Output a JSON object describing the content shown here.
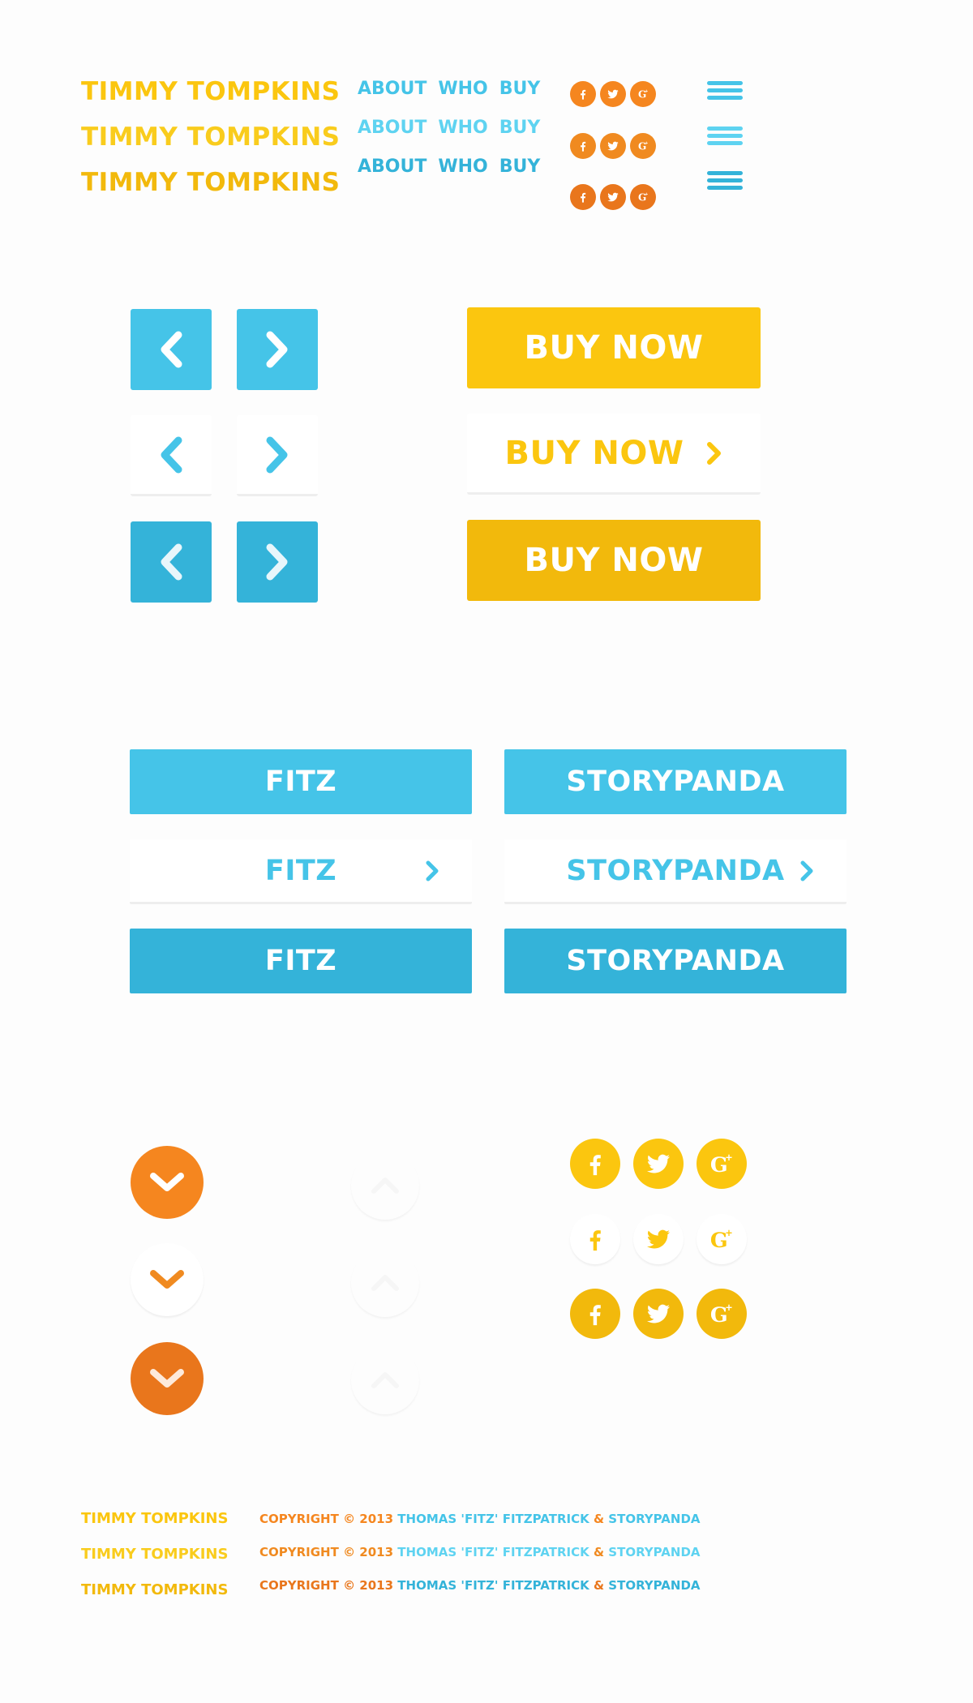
{
  "colors": {
    "yellow_1": "#fbc60f",
    "yellow_2": "#f9cc1d",
    "yellow_3": "#f2b90c",
    "blue_1": "#45c4e8",
    "blue_2": "#5ed3f1",
    "blue_3": "#34b3d9",
    "orange_1": "#f5861f",
    "orange_2": "#f08a20",
    "orange_3": "#e9761c",
    "white": "#ffffff"
  },
  "logo_text": "TIMMY TOMPKINS",
  "nav": [
    "ABOUT",
    "WHO",
    "BUY"
  ],
  "social_icons": [
    "facebook-icon",
    "twitter-icon",
    "google-plus-icon"
  ],
  "arrows": {
    "prev_icon": "chevron-left-icon",
    "next_icon": "chevron-right-icon"
  },
  "buy_label": "BUY NOW",
  "buttons": {
    "fitz": "FITZ",
    "storypanda": "STORYPANDA"
  },
  "down_icon": "chevron-down-icon",
  "up_icon": "chevron-up-icon",
  "footer": {
    "logo": "TIMMY TOMPKINS",
    "copyright": "COPYRIGHT © 2013",
    "author": "THOMAS 'FITZ' FITZPATRICK",
    "amp": "&",
    "company": "STORYPANDA"
  }
}
